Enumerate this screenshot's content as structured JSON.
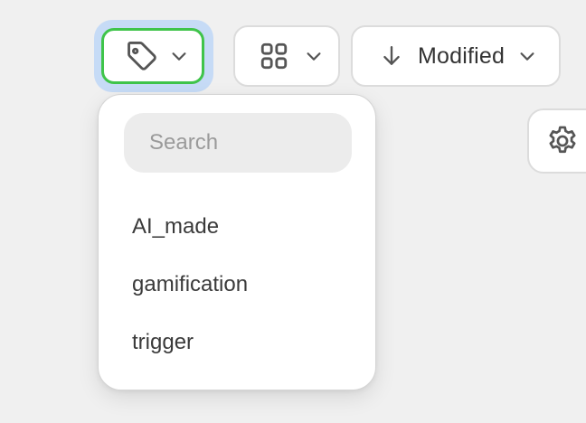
{
  "toolbar": {
    "tag_filter": {
      "icon": "tag-icon",
      "chevron": "chevron-down-icon",
      "focused": true
    },
    "view_mode": {
      "icon": "grid-icon",
      "chevron": "chevron-down-icon"
    },
    "sort": {
      "icon": "arrow-down-icon",
      "label": "Modified",
      "chevron": "chevron-down-icon"
    },
    "settings": {
      "icon": "gear-icon"
    }
  },
  "tag_dropdown": {
    "search": {
      "placeholder": "Search",
      "value": ""
    },
    "items": [
      {
        "label": "AI_made"
      },
      {
        "label": "gamification"
      },
      {
        "label": "trigger"
      }
    ]
  },
  "colors": {
    "focus_outline": "#3fc44a",
    "focus_ring": "#c6dbf6",
    "background": "#f0f0f0",
    "icon": "#555555"
  }
}
